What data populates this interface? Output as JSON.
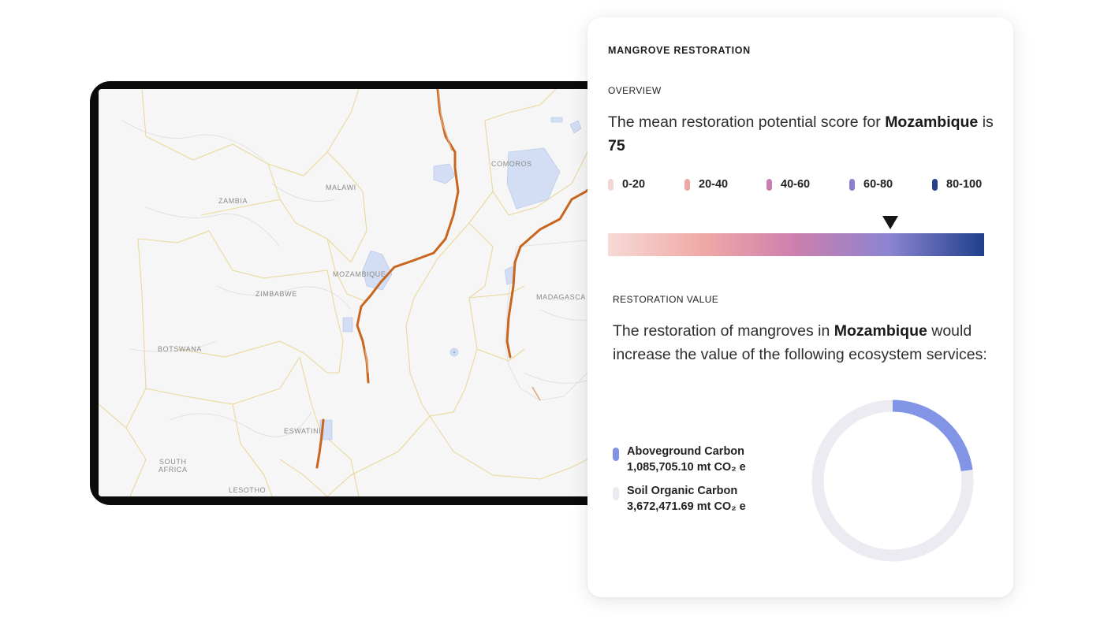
{
  "map": {
    "labels": {
      "zambia": "ZAMBIA",
      "malawi": "MALAWI",
      "comoros": "COMOROS",
      "mozambique": "MOZAMBIQUE",
      "zimbabwe": "ZIMBABWE",
      "madagascar": "MADAGASCA",
      "botswana": "BOTSWANA",
      "eswatini": "ESWATINI",
      "south_africa": "SOUTH\nAFRICA",
      "lesotho": "LESOTHO"
    },
    "colors": {
      "land": "#f6f6f6",
      "border": "#ead89a",
      "minor_border": "#d6d6d6",
      "mangrove": "#c8661f",
      "protected_area": "#d3ddf3"
    }
  },
  "panel": {
    "title": "MANGROVE RESTORATION",
    "overview": {
      "heading": "OVERVIEW",
      "text_prefix": "The mean restoration potential score for ",
      "country": "Mozambique",
      "text_mid": " is ",
      "score": "75"
    },
    "legend": [
      {
        "label": "0-20",
        "color": "#f3d6d3"
      },
      {
        "label": "20-40",
        "color": "#eea8a1"
      },
      {
        "label": "40-60",
        "color": "#c97fb1"
      },
      {
        "label": "60-80",
        "color": "#8d7fce"
      },
      {
        "label": "80-100",
        "color": "#263f8a"
      }
    ],
    "score_marker_value": 75,
    "gradient_colors": [
      "#f6d9d6",
      "#f0aaa6",
      "#cc7fae",
      "#8a84d1",
      "#203f8c"
    ],
    "restoration": {
      "heading": "RESTORATION VALUE",
      "text_prefix": "The restoration of mangroves in ",
      "country": "Mozambique",
      "text_suffix": " would increase the value of the following ecosystem services:"
    },
    "services": [
      {
        "name": "Aboveground Carbon",
        "value": "1,085,705.10  mt CO₂ e",
        "color": "#8194e6",
        "amount": 1085705.1
      },
      {
        "name": "Soil Organic Carbon",
        "value": "3,672,471.69  mt CO₂ e",
        "color": "#ebebf1",
        "amount": 3672471.69
      }
    ]
  }
}
